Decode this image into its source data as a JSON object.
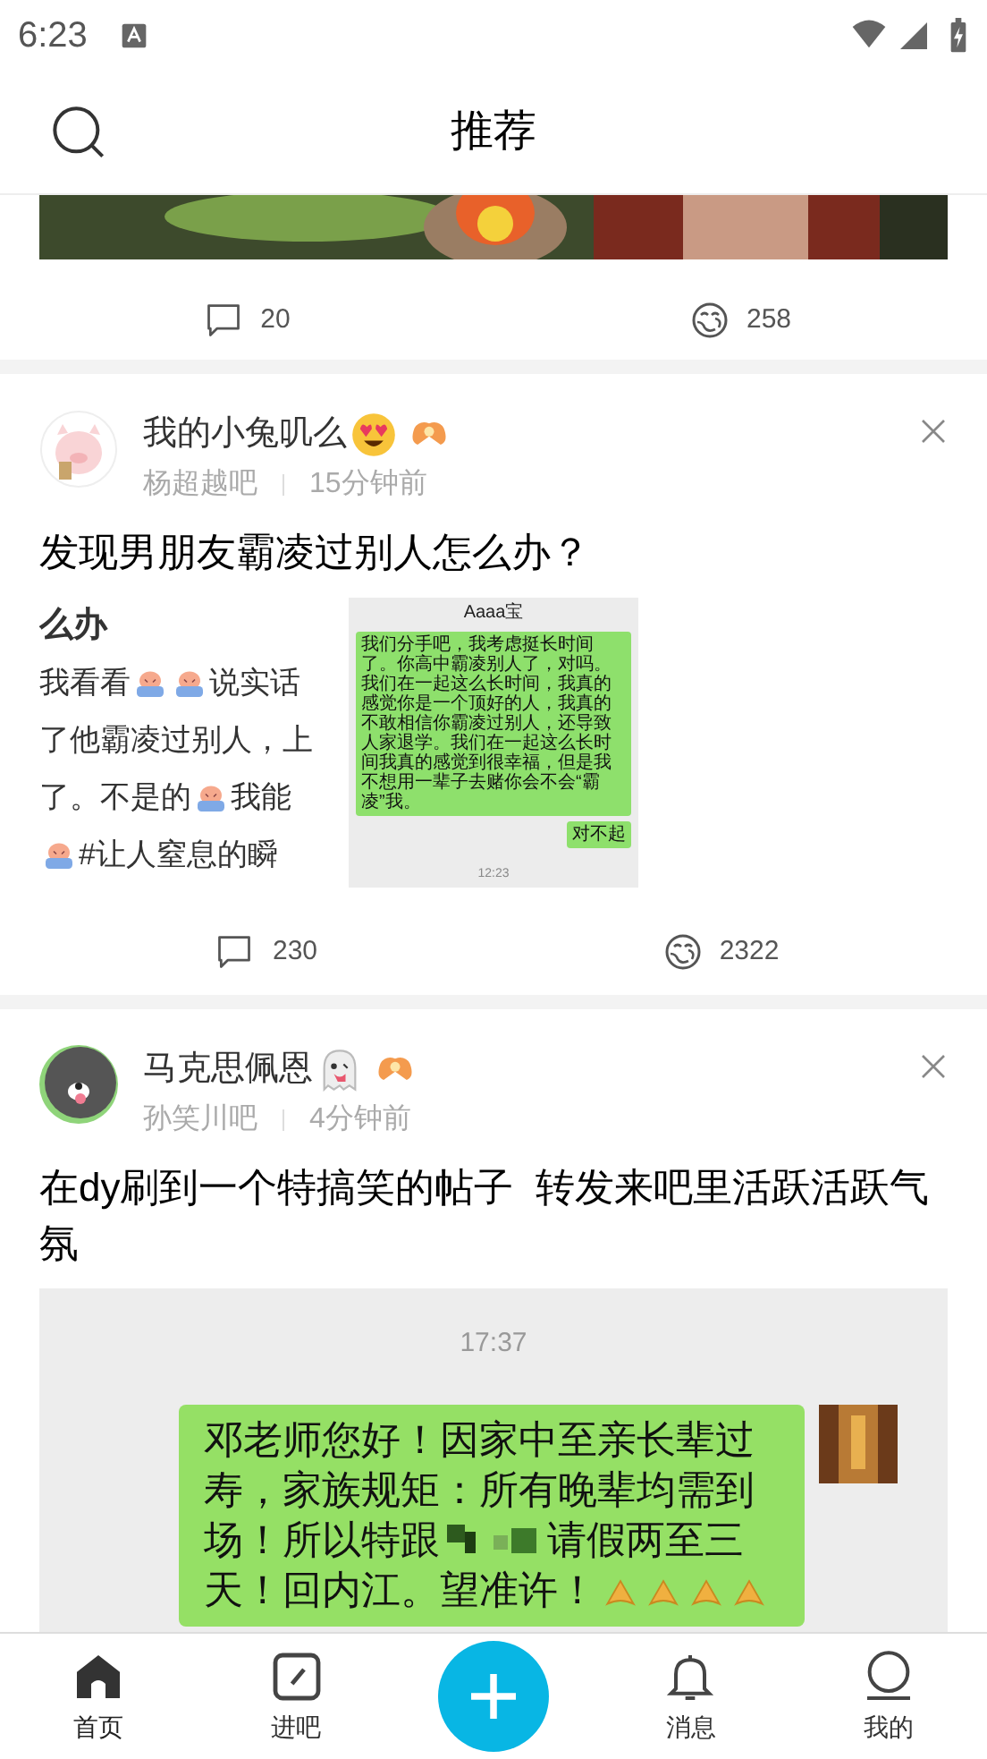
{
  "status_bar": {
    "time": "6:23"
  },
  "header": {
    "title": "推荐"
  },
  "feed": [
    {
      "kind": "tail",
      "comments": "20",
      "likes": "258"
    },
    {
      "kind": "post",
      "author": "我的小兔叽么",
      "forum": "杨超越吧",
      "time": "15分钟前",
      "title": "发现男朋友霸凌过别人怎么办？",
      "images": [
        {
          "kind": "text_crop",
          "lines": [
            {
              "parts": [
                {
                  "kind": "text",
                  "text": "么办"
                }
              ],
              "bold": true
            },
            {
              "parts": [
                {
                  "kind": "text",
                  "text": "我看看"
                },
                {
                  "kind": "emoji"
                },
                {
                  "kind": "emoji"
                },
                {
                  "kind": "text",
                  "text": "说实话"
                }
              ],
              "bold": false
            },
            {
              "parts": [
                {
                  "kind": "text",
                  "text": "了他霸凌过别人，上"
                }
              ],
              "bold": false
            },
            {
              "parts": [
                {
                  "kind": "text",
                  "text": "了。不是的"
                },
                {
                  "kind": "emoji"
                },
                {
                  "kind": "text",
                  "text": "我能"
                }
              ],
              "bold": false
            },
            {
              "parts": [
                {
                  "kind": "emoji"
                },
                {
                  "kind": "text",
                  "text": "#让人窒息的瞬"
                }
              ],
              "bold": false
            }
          ]
        },
        {
          "kind": "chat",
          "contact": "Aaaa宝",
          "messages": [
            {
              "text": "我们分手吧，我考虑挺长时间了。你高中霸凌别人了，对吗。我们在一起这么长时间，我真的感觉你是一个顶好的人，我真的不敢相信你霸凌过别人，还导致人家退学。我们在一起这么长时间我真的感觉到很幸福，但是我不想用一辈子去赌你会不会“霸凌”我。"
            },
            {
              "text": "对不起"
            }
          ],
          "timestamp": "12:23"
        }
      ],
      "comments": "230",
      "likes": "2322"
    },
    {
      "kind": "post",
      "author": "马克思佩恩",
      "forum": "孙笑川吧",
      "time": "4分钟前",
      "title": "在dy刷到一个特搞笑的帖子  转发来吧里活跃活跃气氛",
      "images": [
        {
          "kind": "chat_large",
          "timestamp": "17:37",
          "lines": [
            [
              {
                "kind": "text",
                "text": "邓老师您好！因家中至亲长辈过"
              }
            ],
            [
              {
                "kind": "text",
                "text": "寿，家族规矩：所有晚辈均需到"
              }
            ],
            [
              {
                "kind": "text",
                "text": "场！所以特跟"
              },
              {
                "kind": "blur"
              },
              {
                "kind": "text",
                "text": "请假两至三"
              }
            ],
            [
              {
                "kind": "text",
                "text": "天！回内江。望准许！"
              },
              {
                "kind": "emoji"
              },
              {
                "kind": "emoji"
              },
              {
                "kind": "emoji"
              },
              {
                "kind": "emoji"
              }
            ]
          ]
        }
      ]
    }
  ],
  "bottom_nav": [
    {
      "kind": "home",
      "label": "首页",
      "selected": true
    },
    {
      "kind": "forum",
      "label": "进吧",
      "selected": false
    },
    {
      "kind": "add"
    },
    {
      "kind": "bell",
      "label": "消息",
      "selected": false
    },
    {
      "kind": "profile",
      "label": "我的",
      "selected": false
    }
  ]
}
